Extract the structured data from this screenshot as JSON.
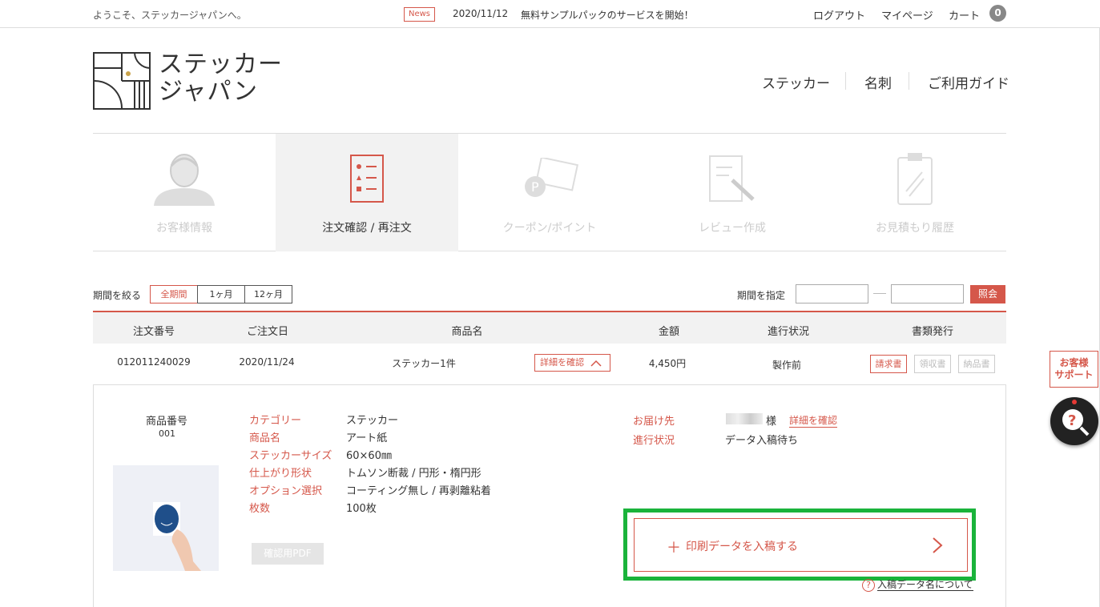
{
  "topbar": {
    "welcome": "ようこそ、ステッカージャパンへ。",
    "news_badge": "News",
    "news_date": "2020/11/12",
    "news_text": "無料サンプルパックのサービスを開始！",
    "logout": "ログアウト",
    "mypage": "マイページ",
    "cart": "カート",
    "cart_count": "0"
  },
  "header": {
    "logo_line1": "ステッカー",
    "logo_line2": "ジャパン",
    "nav": [
      "ステッカー",
      "名刺",
      "ご利用ガイド"
    ]
  },
  "tabs": [
    {
      "label": "お客様情報",
      "icon": "user-icon"
    },
    {
      "label": "注文確認 / 再注文",
      "icon": "order-list-icon"
    },
    {
      "label": "クーポン/ポイント",
      "icon": "coupon-icon"
    },
    {
      "label": "レビュー作成",
      "icon": "review-icon"
    },
    {
      "label": "お見積もり履歴",
      "icon": "clipboard-icon"
    }
  ],
  "filter": {
    "label": "期間を絞る",
    "periods": [
      "全期間",
      "1ヶ月",
      "12ヶ月"
    ],
    "range_label": "期間を指定",
    "from_value": "",
    "to_value": "",
    "search": "照会"
  },
  "table": {
    "headers": [
      "注文番号",
      "ご注文日",
      "商品名",
      "金額",
      "進行状況",
      "書類発行"
    ],
    "row": {
      "order_no": "012011240029",
      "date": "2020/11/24",
      "product": "ステッカー1件",
      "detail_btn": "詳細を確認",
      "amount": "4,450円",
      "status": "製作前",
      "docs": [
        "請求書",
        "領収書",
        "納品書"
      ]
    }
  },
  "detail": {
    "pnum_label": "商品番号",
    "pnum_value": "001",
    "specs": [
      {
        "label": "カテゴリー",
        "value": "ステッカー"
      },
      {
        "label": "商品名",
        "value": "アート紙"
      },
      {
        "label": "ステッカーサイズ",
        "value": "60×60㎜"
      },
      {
        "label": "仕上がり形状",
        "value": "トムソン断裁 / 円形・楕円形"
      },
      {
        "label": "オプション選択",
        "value": "コーティング無し / 再剥離粘着"
      },
      {
        "label": "枚数",
        "value": "100枚"
      }
    ],
    "pdf_btn": "確認用PDF",
    "delivery_label": "お届け先",
    "delivery_suffix": "様",
    "delivery_link": "詳細を確認",
    "progress_label": "進行状況",
    "progress_value": "データ入稿待ち",
    "upload_btn": "印刷データを入稿する",
    "help_link": "入稿データ名について"
  },
  "support": {
    "line1": "お客様",
    "line2": "サポート"
  },
  "colors": {
    "accent": "#d5574a",
    "highlight": "#1ab33b"
  }
}
